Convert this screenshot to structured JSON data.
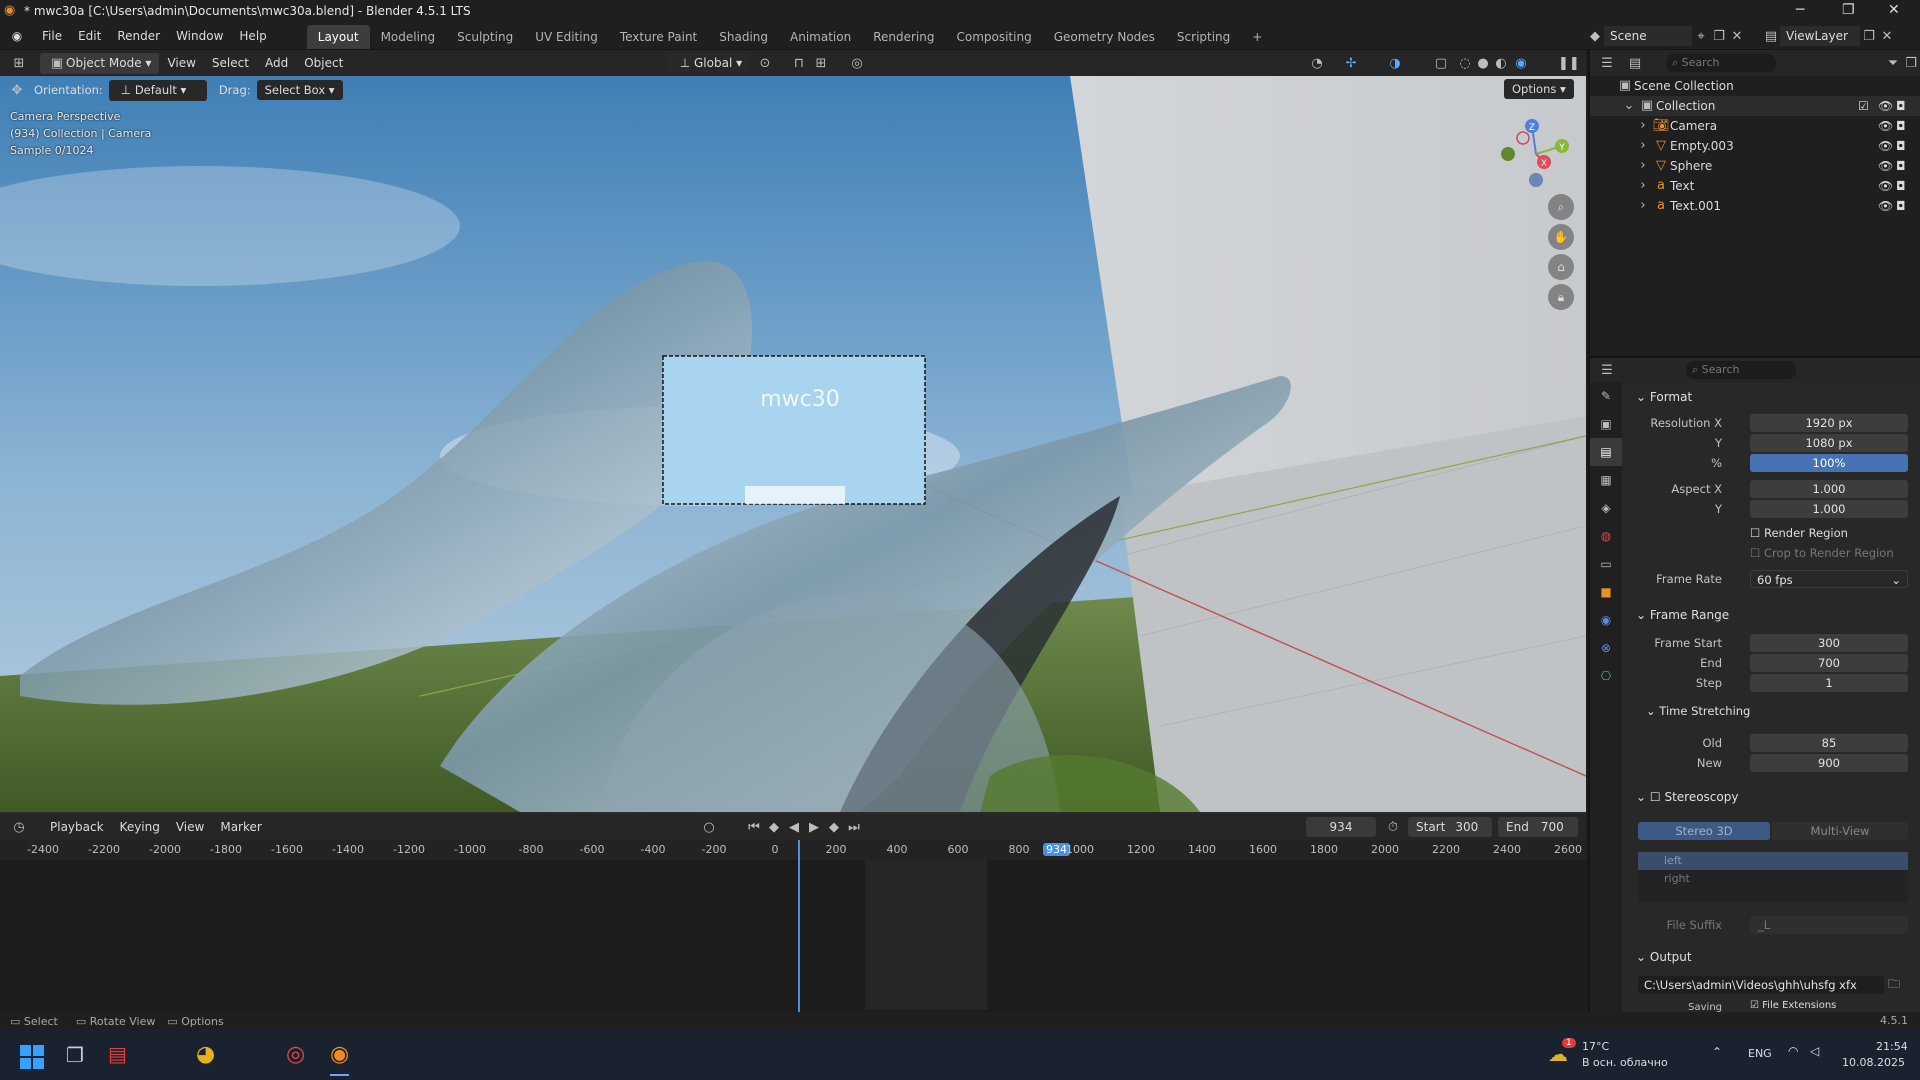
{
  "window": {
    "title": "* mwc30a [C:\\Users\\admin\\Documents\\mwc30a.blend] - Blender 4.5.1 LTS"
  },
  "menu": [
    "File",
    "Edit",
    "Render",
    "Window",
    "Help"
  ],
  "workspaces": [
    "Layout",
    "Modeling",
    "Sculpting",
    "UV Editing",
    "Texture Paint",
    "Shading",
    "Animation",
    "Rendering",
    "Compositing",
    "Geometry Nodes",
    "Scripting"
  ],
  "scene": {
    "label": "Scene",
    "view_layer": "ViewLayer"
  },
  "viewport_header": {
    "mode": "Object Mode",
    "view": "View",
    "select": "Select",
    "add": "Add",
    "object": "Object",
    "transform": "Global",
    "options": "Options",
    "orientation_label": "Orientation:",
    "orientation_value": "Default",
    "drag_label": "Drag:",
    "drag_value": "Select Box"
  },
  "viewport": {
    "line1": "Camera Perspective",
    "line2": "(934) Collection | Camera",
    "line3": "Sample 0/1024",
    "gizmo": {
      "z": "Z",
      "y": "Y",
      "x": "X"
    }
  },
  "outliner": {
    "search_placeholder": "Search",
    "root": "Scene Collection",
    "collection": "Collection",
    "items": [
      {
        "name": "Camera",
        "icon": "camera-icon"
      },
      {
        "name": "Empty.003",
        "icon": "empty-icon"
      },
      {
        "name": "Sphere",
        "icon": "mesh-icon"
      },
      {
        "name": "Text",
        "icon": "text-icon"
      },
      {
        "name": "Text.001",
        "icon": "text-icon"
      }
    ]
  },
  "properties": {
    "search_placeholder": "Search",
    "format": {
      "header": "Format",
      "res_x_label": "Resolution X",
      "res_x": "1920 px",
      "res_y_label": "Y",
      "res_y": "1080 px",
      "pct_label": "%",
      "pct": "100%",
      "aspect_x_label": "Aspect X",
      "aspect_x": "1.000",
      "aspect_y_label": "Y",
      "aspect_y": "1.000",
      "render_region": "Render Region",
      "crop": "Crop to Render Region",
      "frame_rate_label": "Frame Rate",
      "frame_rate": "60 fps"
    },
    "frame_range": {
      "header": "Frame Range",
      "start_label": "Frame Start",
      "start": "300",
      "end_label": "End",
      "end": "700",
      "step_label": "Step",
      "step": "1",
      "ts_header": "Time Stretching",
      "old_label": "Old",
      "old": "85",
      "new_label": "New",
      "new": "900"
    },
    "stereo": {
      "header": "Stereoscopy",
      "tab1": "Stereo 3D",
      "tab2": "Multi-View",
      "left": "left",
      "right": "right",
      "suffix_label": "File Suffix",
      "suffix": "_L"
    },
    "output": {
      "header": "Output",
      "path": "C:\\Users\\admin\\Videos\\ghh\\uhsfg xfx",
      "saving": "Saving",
      "file_ext": "File Extensions"
    }
  },
  "timeline": {
    "menus": [
      "Playback",
      "Keying",
      "View",
      "Marker"
    ],
    "current_frame": "934",
    "start_label": "Start",
    "start": "300",
    "end_label": "End",
    "end": "700",
    "ticks": [
      "-2400",
      "-2200",
      "-2000",
      "-1800",
      "-1600",
      "-1400",
      "-1200",
      "-1000",
      "-800",
      "-600",
      "-400",
      "-200",
      "0",
      "200",
      "400",
      "600",
      "800",
      "934",
      "1000",
      "1200",
      "1400",
      "1600",
      "1800",
      "2000",
      "2200",
      "2400",
      "2600"
    ]
  },
  "status": {
    "select": "Select",
    "rotate": "Rotate View",
    "options": "Options",
    "version": "4.5.1"
  },
  "taskbar": {
    "weather_temp": "17°C",
    "weather_desc": "В осн. облачно",
    "badge": "1",
    "lang": "ENG",
    "time": "21:54",
    "date": "10.08.2025"
  }
}
